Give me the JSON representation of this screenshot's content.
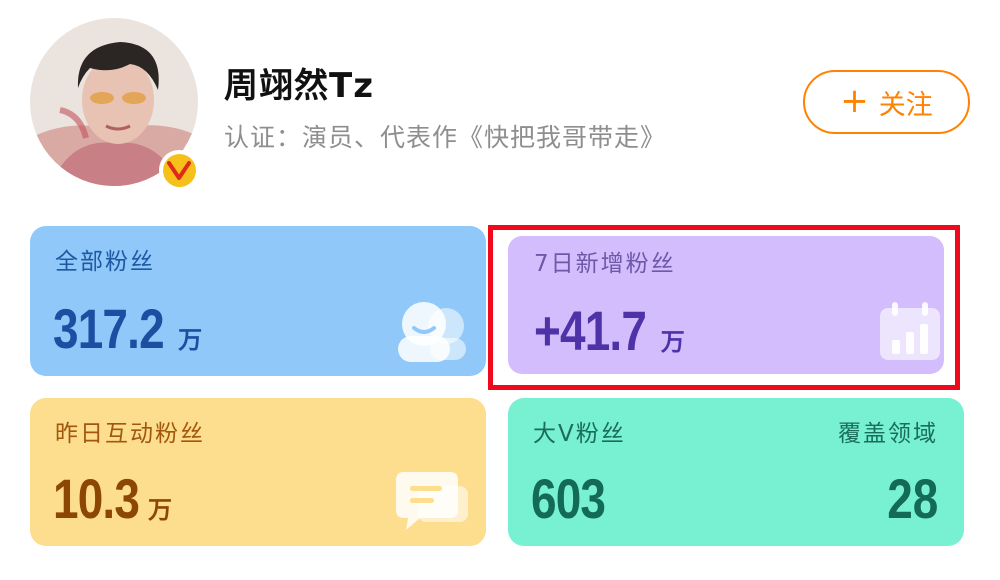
{
  "profile": {
    "name": "周翊然Tz",
    "certification": "认证：演员、代表作《快把我哥带走》",
    "avatar_icon": "user-avatar",
    "verified_badge_icon": "verified-v-badge",
    "verified_badge_color": "#f6c01a"
  },
  "follow_button": {
    "icon": "plus-icon",
    "icon_glyph": "+",
    "label": "关注",
    "color": "#ff8200"
  },
  "stats": {
    "all_fans": {
      "label": "全部粉丝",
      "value": "317.2",
      "unit": "万",
      "icon": "fans-group-icon"
    },
    "new_fans_7d": {
      "label": "7日新增粉丝",
      "value": "+41.7",
      "unit": "万",
      "icon": "calendar-chart-icon",
      "highlighted": true,
      "highlight_color": "#f0091b"
    },
    "yesterday_interactive_fans": {
      "label": "昨日互动粉丝",
      "value": "10.3",
      "unit": "万",
      "icon": "chat-bubble-icon"
    },
    "big_v_fans": {
      "label": "大V粉丝",
      "value": "603",
      "coverage_label": "覆盖领域",
      "coverage_value": "28"
    }
  },
  "colors": {
    "card_all_bg": "#8fc8f9",
    "card_7d_bg": "#d3bdfd",
    "card_yesterday_bg": "#fddd8e",
    "card_bigv_bg": "#78f1d3"
  }
}
